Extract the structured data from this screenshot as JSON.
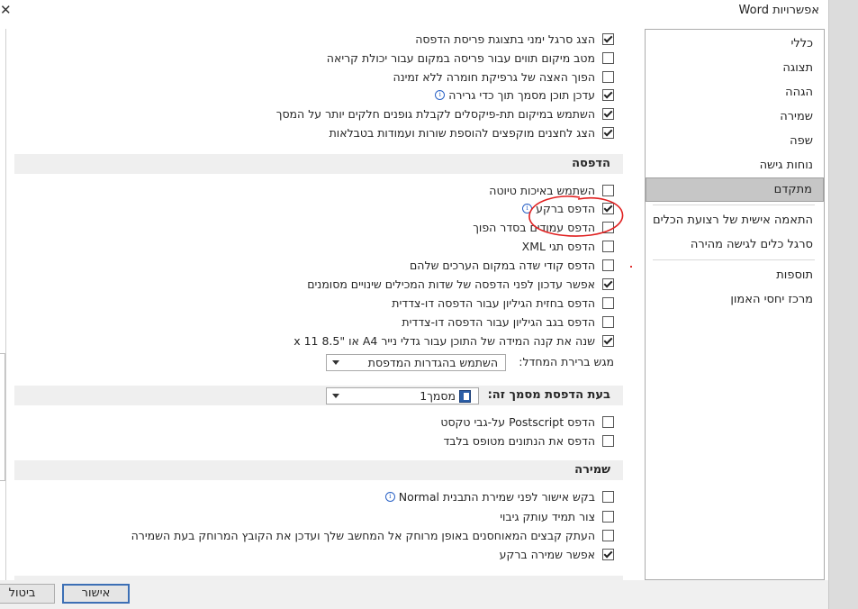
{
  "window": {
    "title": "אפשרויות Word",
    "close_label": "✕"
  },
  "sidebar": {
    "items": [
      {
        "label": "כללי"
      },
      {
        "label": "תצוגה"
      },
      {
        "label": "הגהה"
      },
      {
        "label": "שמירה"
      },
      {
        "label": "שפה"
      },
      {
        "label": "נוחות גישה"
      },
      {
        "label": "מתקדם",
        "selected": true
      },
      {
        "label": "התאמה אישית של רצועת הכלים"
      },
      {
        "label": "סרגל כלים לגישה מהירה"
      },
      {
        "label": "תוספות"
      },
      {
        "label": "מרכז יחסי האמון"
      }
    ]
  },
  "display_options": [
    {
      "label": "הצג סרגל ימני בתצוגת פריסת הדפסה",
      "checked": true
    },
    {
      "label": "מטב מיקום תווים עבור פריסה במקום עבור יכולת קריאה",
      "checked": false
    },
    {
      "label": "הפוך האצה של גרפיקת חומרה ללא זמינה",
      "checked": false
    },
    {
      "label": "עדכן תוכן מסמך תוך כדי גרירה",
      "checked": true,
      "info": true
    },
    {
      "label": "השתמש במיקום תת-פיקסלים לקבלת גופנים חלקים יותר על המסך",
      "checked": true
    },
    {
      "label": "הצג לחצנים מוקפצים להוספת שורות ועמודות בטבלאות",
      "checked": true
    }
  ],
  "print_section": {
    "title": "הדפסה",
    "options": [
      {
        "label": "השתמש באיכות טיוטה",
        "checked": false
      },
      {
        "label": "הדפס ברקע",
        "checked": true,
        "info": true
      },
      {
        "label": "הדפס עמודים בסדר הפוך",
        "checked": false
      },
      {
        "label": "הדפס תגי XML",
        "checked": false
      },
      {
        "label": "הדפס קודי שדה במקום הערכים שלהם",
        "checked": false
      },
      {
        "label": "אפשר עדכון לפני הדפסה של שדות המכילים שינויים מסומנים",
        "checked": true
      },
      {
        "label": "הדפס בחזית הגיליון עבור הדפסה דו-צדדית",
        "checked": false
      },
      {
        "label": "הדפס בגב הגיליון עבור הדפסה דו-צדדית",
        "checked": false
      },
      {
        "label": "שנה את קנה המידה של התוכן עבור גדלי נייר A4 או \"8.5 x 11",
        "checked": true
      }
    ],
    "tray_label": "מגש ברירת המחדל:",
    "tray_value": "השתמש בהגדרות המדפסת"
  },
  "print_doc_section": {
    "title": "בעת הדפסת מסמך זה:",
    "doc_value": "מסמך1",
    "options": [
      {
        "label": "הדפס Postscript על-גבי טקסט",
        "checked": false
      },
      {
        "label": "הדפס את הנתונים מטופס בלבד",
        "checked": false
      }
    ]
  },
  "save_section": {
    "title": "שמירה",
    "options": [
      {
        "label": "בקש אישור לפני שמירת התבנית Normal",
        "checked": false,
        "info": true
      },
      {
        "label": "צור תמיד עותק גיבוי",
        "checked": false
      },
      {
        "label": "העתק קבצים המאוחסנים באופן מרוחק אל המחשב שלך ועדכן את הקובץ המרוחק בעת השמירה",
        "checked": false
      },
      {
        "label": "אפשר שמירה ברקע",
        "checked": true
      }
    ]
  },
  "buttons": {
    "ok": "אישור",
    "cancel": "ביטול"
  },
  "annotation": {
    "color": "#e02020"
  }
}
